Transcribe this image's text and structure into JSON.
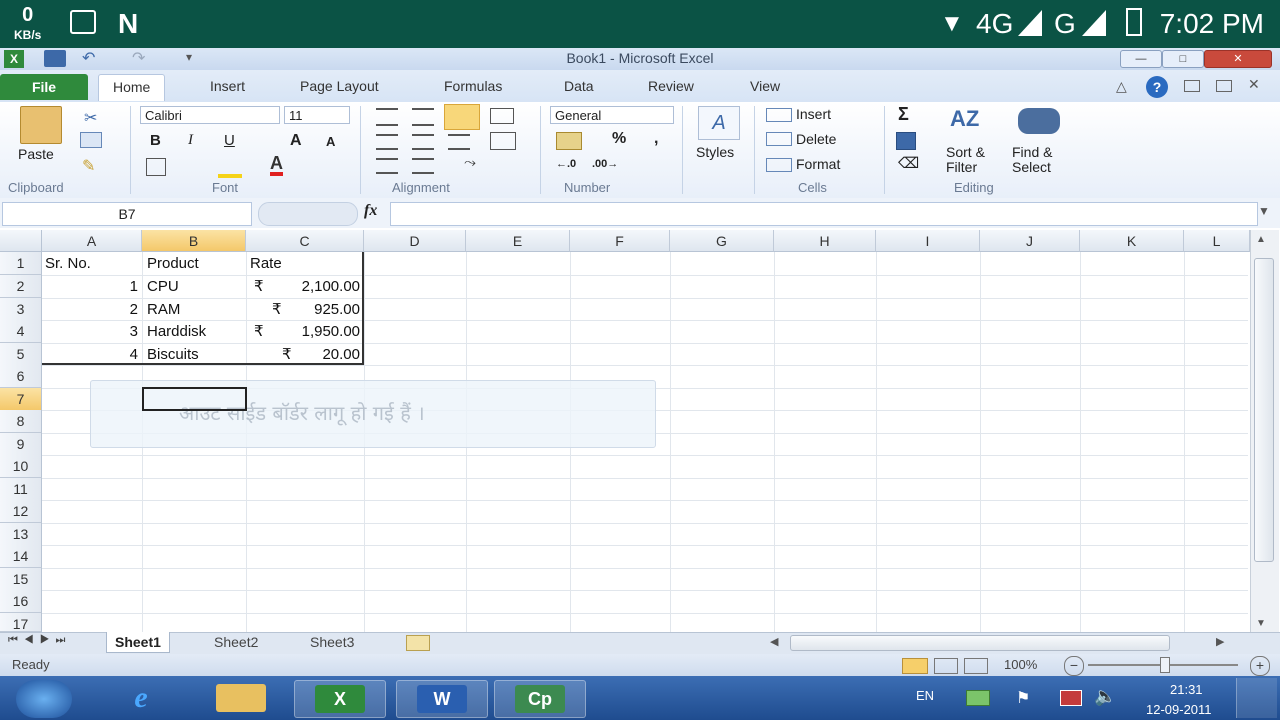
{
  "android": {
    "kb_value": "0",
    "kb_unit": "KB/s",
    "net1": "4G",
    "net2": "G",
    "time": "7:02 PM"
  },
  "window": {
    "title": "Book1  -  Microsoft Excel"
  },
  "ribbon": {
    "tabs": [
      "File",
      "Home",
      "Insert",
      "Page Layout",
      "Formulas",
      "Data",
      "Review",
      "View"
    ],
    "clipboard": {
      "paste": "Paste",
      "group": "Clipboard"
    },
    "font": {
      "name": "Calibri",
      "size": "11",
      "group": "Font"
    },
    "alignment": {
      "group": "Alignment"
    },
    "number": {
      "format": "General",
      "group": "Number"
    },
    "styles": {
      "label": "Styles"
    },
    "cells": {
      "insert": "Insert",
      "delete": "Delete",
      "format": "Format",
      "group": "Cells"
    },
    "editing": {
      "sort1": "Sort &",
      "sort2": "Filter",
      "find1": "Find &",
      "find2": "Select",
      "group": "Editing"
    }
  },
  "formula_bar": {
    "name_box": "B7",
    "fx": "fx",
    "value": ""
  },
  "columns": [
    "A",
    "B",
    "C",
    "D",
    "E",
    "F",
    "G",
    "H",
    "I",
    "J",
    "K",
    "L"
  ],
  "rows": [
    "1",
    "2",
    "3",
    "4",
    "5",
    "6",
    "7",
    "8",
    "9",
    "10",
    "11",
    "12",
    "13",
    "14",
    "15",
    "16",
    "17"
  ],
  "table": {
    "headers": [
      "Sr. No.",
      "Product",
      "Rate"
    ],
    "rows": [
      {
        "sr": "1",
        "product": "CPU",
        "cur": "₹",
        "rate": "2,100.00"
      },
      {
        "sr": "2",
        "product": "RAM",
        "cur": "₹",
        "rate": "925.00"
      },
      {
        "sr": "3",
        "product": "Harddisk",
        "cur": "₹",
        "rate": "1,950.00"
      },
      {
        "sr": "4",
        "product": "Biscuits",
        "cur": "₹",
        "rate": "20.00"
      }
    ]
  },
  "selected_cell": "B7",
  "tooltip": {
    "text": "आउट साईड बॉर्डर लागू हो गई हैं ।"
  },
  "sheets": [
    "Sheet1",
    "Sheet2",
    "Sheet3"
  ],
  "status": {
    "ready": "Ready",
    "zoom": "100%"
  },
  "taskbar": {
    "lang": "EN",
    "time": "21:31",
    "date": "12-09-2011",
    "apps": [
      "Internet Explorer",
      "Folder",
      "Excel",
      "Word",
      "Cp"
    ]
  }
}
